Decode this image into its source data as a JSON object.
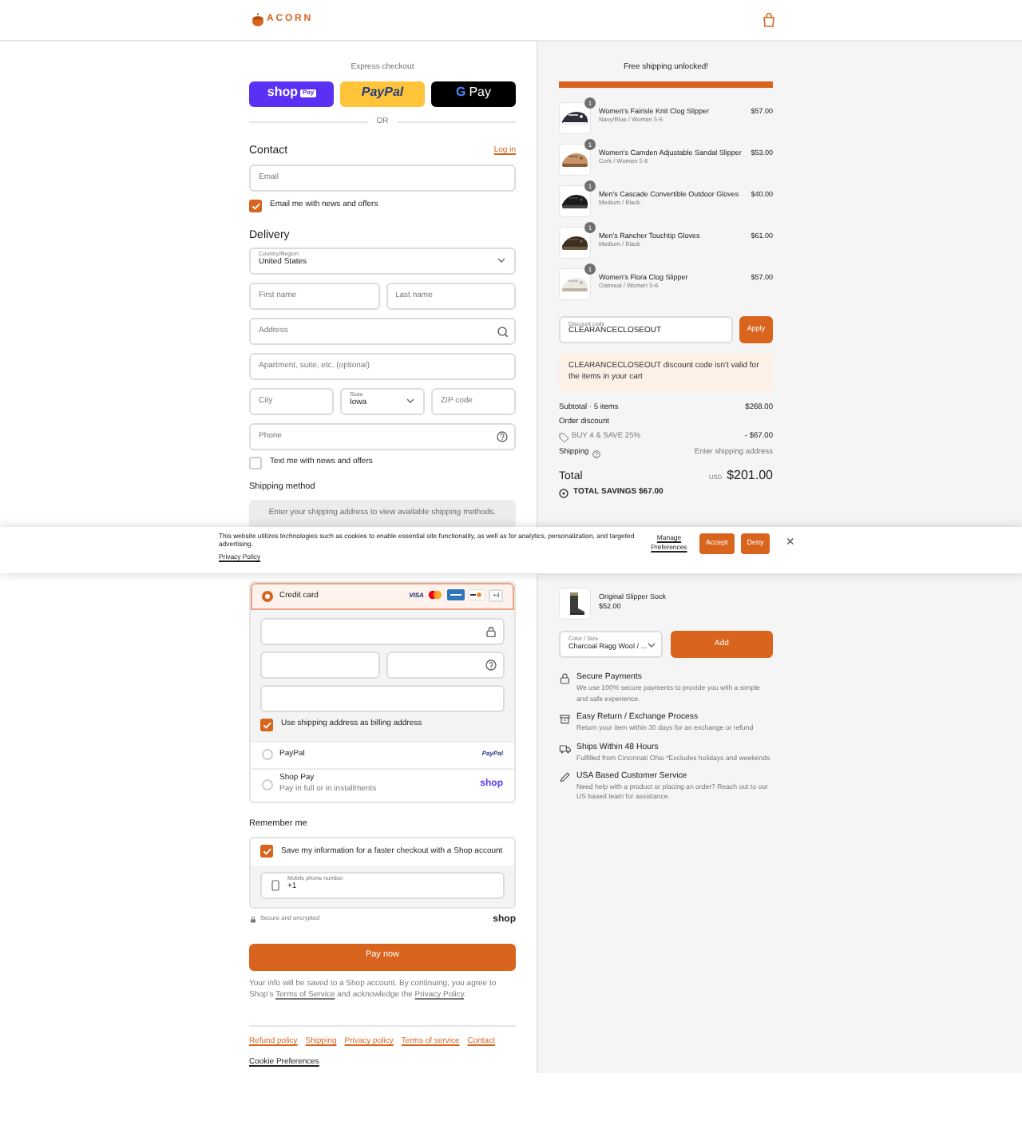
{
  "header": {
    "logo": "ACORN"
  },
  "express_checkout": {
    "title": "Express checkout",
    "buttons": [
      {
        "kind": "shoppay",
        "label": "shop",
        "badge": "Pay"
      },
      {
        "kind": "paypal",
        "label": "PayPal"
      },
      {
        "kind": "gpay",
        "letter": "G",
        "label": "Pay"
      }
    ],
    "separator": "OR"
  },
  "contact": {
    "title": "Contact",
    "login": "Log in",
    "email": {
      "placeholder": "Email"
    },
    "newsletter": {
      "label": "Email me with news and offers",
      "checked": true
    }
  },
  "delivery": {
    "title": "Delivery",
    "rows": [
      [
        {
          "kind": "select",
          "label": "Country/Region",
          "value": "United States"
        }
      ],
      [
        {
          "kind": "input",
          "placeholder": "First name"
        },
        {
          "kind": "input",
          "placeholder": "Last name"
        }
      ],
      [
        {
          "kind": "search_input",
          "placeholder": "Address"
        }
      ],
      [
        {
          "kind": "input",
          "placeholder": "Apartment, suite, etc. (optional)"
        }
      ],
      [
        {
          "kind": "input",
          "placeholder": "City"
        },
        {
          "kind": "select",
          "label": "State",
          "value": "Iowa"
        },
        {
          "kind": "input",
          "placeholder": "ZIP code"
        }
      ],
      [
        {
          "kind": "help_input",
          "placeholder": "Phone"
        }
      ]
    ],
    "sms": {
      "label": "Text me with news and offers",
      "checked": false
    }
  },
  "shipping_method": {
    "title": "Shipping method",
    "notice": "Enter your shipping address to view available shipping methods."
  },
  "payment": {
    "methods": [
      {
        "kind": "card",
        "label": "Credit card",
        "selected": true,
        "brands": [
          {
            "kind": "visa",
            "text": "VISA"
          },
          {
            "kind": "mastercard"
          },
          {
            "kind": "amex"
          },
          {
            "kind": "discover"
          },
          {
            "kind": "more",
            "text": "+4"
          }
        ],
        "card_fields": [
          [
            {
              "kind": "lock_field"
            }
          ],
          [
            {
              "kind": "field"
            },
            {
              "kind": "help_field"
            }
          ],
          [
            {
              "kind": "field"
            }
          ]
        ],
        "billing": {
          "label": "Use shipping address as billing address",
          "checked": true
        }
      },
      {
        "kind": "paypal",
        "label": "PayPal",
        "selected": false,
        "logo": "PayPal"
      },
      {
        "kind": "shoppay",
        "label": "Shop Pay",
        "sublabel": "Pay in full or in installments",
        "selected": false,
        "logo": "shop"
      }
    ]
  },
  "remember": {
    "title": "Remember me",
    "save": {
      "label": "Save my information for a faster checkout with a Shop account",
      "checked": true
    },
    "phone": {
      "label": "Mobile phone number",
      "value": "+1"
    }
  },
  "secure": {
    "text": "Secure and encrypted",
    "logo": "shop"
  },
  "pay_button": "Pay now",
  "legal": [
    {
      "kind": "text",
      "text": "Your info will be saved to a Shop account. By continuing, you agree to Shop’s "
    },
    {
      "kind": "link",
      "text": "Terms of Service"
    },
    {
      "kind": "text",
      "text": " and acknowledge the "
    },
    {
      "kind": "link",
      "text": "Privacy Policy"
    },
    {
      "kind": "text",
      "text": "."
    }
  ],
  "footer_links": [
    "Refund policy",
    "Shipping",
    "Privacy policy",
    "Terms of service",
    "Contact"
  ],
  "cookie_preferences": "Cookie Preferences",
  "summary": {
    "free_shipping": {
      "text": "Free shipping unlocked!",
      "level": 1
    },
    "items": [
      {
        "title": "Women's Fairisle Knit Clog Slipper",
        "variant": "Navy/Blue / Women 5-6",
        "price": "$57.00",
        "quantity": "1"
      },
      {
        "title": "Women's Camden Adjustable Sandal Slipper",
        "variant": "Cork / Women 5-6",
        "price": "$53.00",
        "quantity": "1"
      },
      {
        "title": "Men's Cascade Convertible Outdoor Gloves",
        "variant": "Medium / Black",
        "price": "$40.00",
        "quantity": "1"
      },
      {
        "title": "Men's Rancher Touchtip Gloves",
        "variant": "Medium / Black",
        "price": "$61.00",
        "quantity": "1"
      },
      {
        "title": "Women's Flora Clog Slipper",
        "variant": "Oatmeal / Women 5-6",
        "price": "$57.00",
        "quantity": "1"
      }
    ],
    "discount": {
      "label": "Discount code",
      "value": "CLEARANCECLOSEOUT",
      "button": "Apply",
      "error": "CLEARANCECLOSEOUT discount code isn't valid for the items in your cart"
    },
    "subtotal": {
      "label": "Subtotal · 5 items",
      "value": "$268.00"
    },
    "order_discount": {
      "label": "Order discount",
      "code": "BUY 4 & SAVE 25%",
      "value": "- $67.00"
    },
    "shipping": {
      "label": "Shipping",
      "value": "Enter shipping address"
    },
    "total": {
      "label": "Total",
      "currency": "USD",
      "value": "$201.00"
    },
    "savings": "TOTAL SAVINGS $67.00"
  },
  "upsell": {
    "title": "Original Slipper Sock",
    "price": "$52.00",
    "select_label": "Color / Size",
    "select_value": "Charcoal Ragg Wool / ...",
    "button": "Add"
  },
  "features": [
    {
      "kind": "lock",
      "title": "Secure Payments",
      "text": "We use 100% secure payments to provide you with a simple and safe experience."
    },
    {
      "kind": "return",
      "title": "Easy Return / Exchange Process",
      "text": "Return your item within 30 days for an exchange or refund"
    },
    {
      "kind": "truck",
      "title": "Ships Within 48 Hours",
      "text": "Fulfilled from Cincinnati Ohio *Excludes holidays and weekends"
    },
    {
      "kind": "pen",
      "title": "USA Based Customer Service",
      "text": "Need help with a product or placing an order? Reach out to our US based team for assistance."
    }
  ],
  "cookie_banner": {
    "text": "This website utilizes technologies such as cookies to enable essential site functionality, as well as for analytics, personalization, and targeted advertising.",
    "policy": "Privacy Policy",
    "manage": "Manage Preferences",
    "accept": "Accept",
    "deny": "Deny",
    "close": "×"
  }
}
